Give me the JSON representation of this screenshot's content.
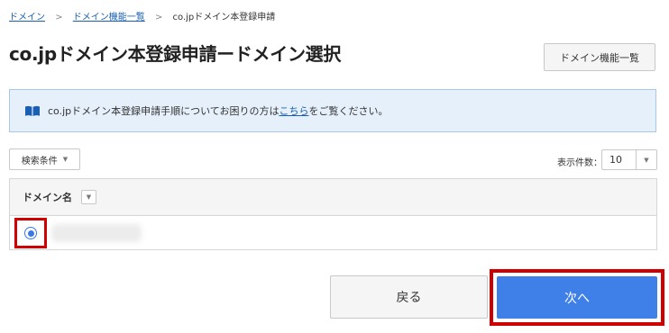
{
  "breadcrumb": {
    "items": [
      "ドメイン",
      "ドメイン機能一覧",
      "co.jpドメイン本登録申請"
    ],
    "separator": ">"
  },
  "page_title": "co.jpドメイン本登録申請ードメイン選択",
  "header_button_label": "ドメイン機能一覧",
  "info": {
    "icon": "book-icon",
    "text_before": "co.jpドメイン本登録申請手順についてお困りの方は",
    "link_text": "こちら",
    "text_after": "をご覧ください。"
  },
  "filter": {
    "search_label": "検索条件",
    "per_page_label": "表示件数：",
    "per_page_value": "10"
  },
  "table": {
    "column_header": "ドメイン名",
    "rows": [
      {
        "selected": true
      }
    ]
  },
  "actions": {
    "back_label": "戻る",
    "next_label": "次へ"
  },
  "colors": {
    "accent": "#3f7fe8",
    "highlight": "#d10000",
    "info_bg": "#e6f0fb"
  }
}
